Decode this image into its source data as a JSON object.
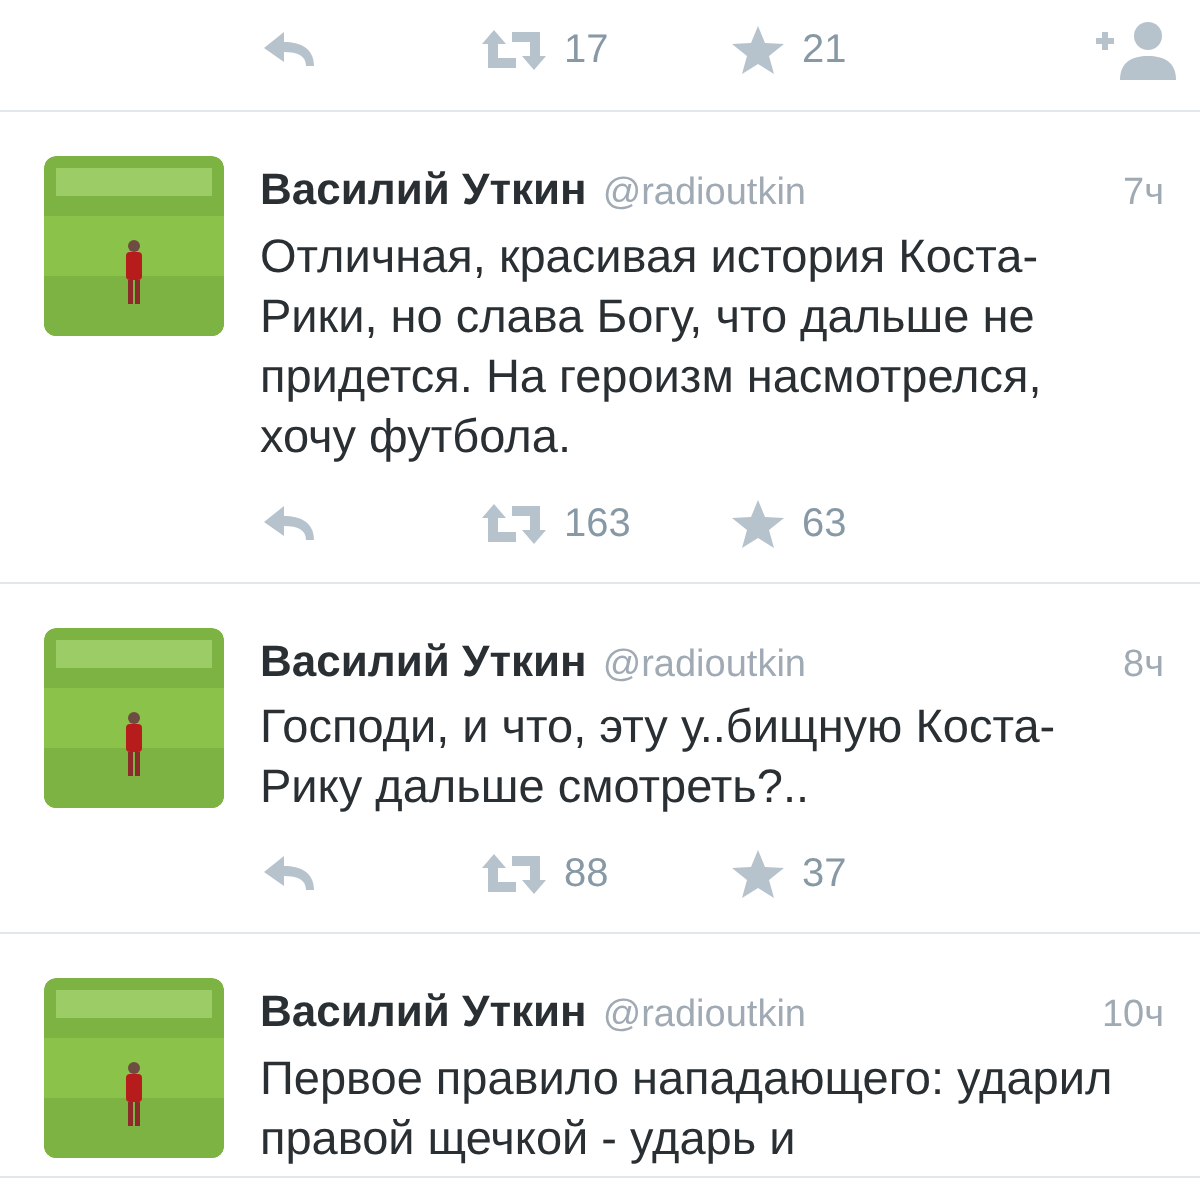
{
  "previous_tweet_actions": {
    "retweets": "17",
    "favorites": "21",
    "follow": true
  },
  "tweets": [
    {
      "name": "Василий Уткин",
      "handle": "@radioutkin",
      "time": "7ч",
      "text": "Отличная, красивая история Коста-Рики, но слава Богу, что дальше не придется. На героизм насмотрелся, хочу футбола.",
      "retweets": "163",
      "favorites": "63",
      "follow": false
    },
    {
      "name": "Василий Уткин",
      "handle": "@radioutkin",
      "time": "8ч",
      "text": "Господи, и что, эту у..бищную Коста-Рику дальше смотреть?..",
      "retweets": "88",
      "favorites": "37",
      "follow": false
    },
    {
      "name": "Василий Уткин",
      "handle": "@radioutkin",
      "time": "10ч",
      "text": "Первое правило нападающего: ударил правой щечкой - ударь и"
    }
  ]
}
